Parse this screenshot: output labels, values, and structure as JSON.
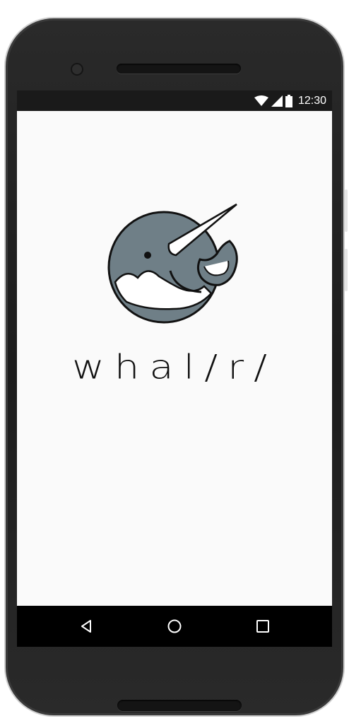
{
  "status_bar": {
    "time": "12:30",
    "icons": [
      "wifi-icon",
      "cellular-signal-icon",
      "battery-icon"
    ]
  },
  "app": {
    "wordmark": "whal/r/",
    "logo_icon": "narwhal-logo-icon",
    "colors": {
      "whale_body": "#6f7f87",
      "outline": "#111111",
      "background": "#fafafa"
    }
  },
  "nav_bar": {
    "buttons": [
      "back-icon",
      "home-icon",
      "recents-icon"
    ]
  }
}
